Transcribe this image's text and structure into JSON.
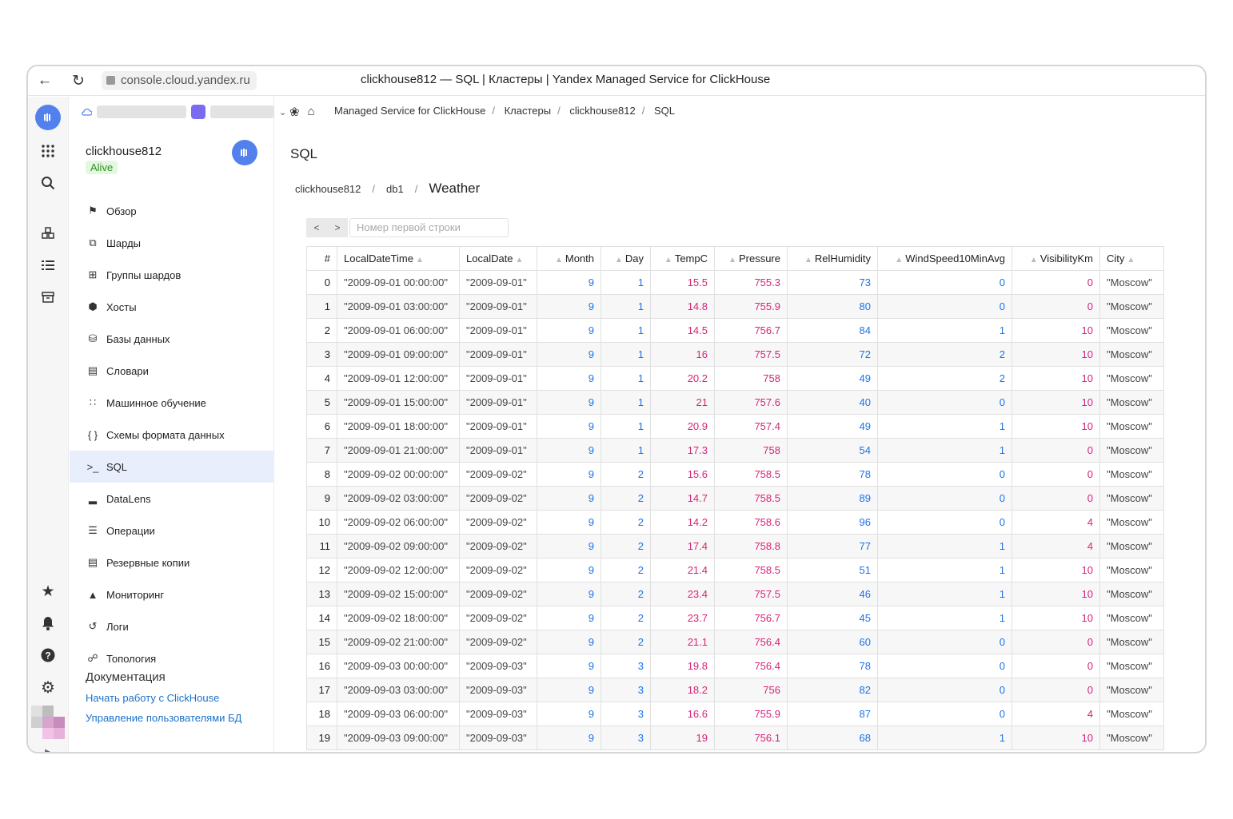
{
  "browser": {
    "url": "console.cloud.yandex.ru",
    "title": "clickhouse812 — SQL | Кластеры | Yandex Managed Service for ClickHouse"
  },
  "cluster": {
    "name": "clickhouse812",
    "status": "Alive"
  },
  "breadcrumbs": [
    "Managed Service for ClickHouse",
    "Кластеры",
    "clickhouse812",
    "SQL"
  ],
  "menu": [
    {
      "label": "Обзор",
      "icon": "flag-icon"
    },
    {
      "label": "Шарды",
      "icon": "shards-icon"
    },
    {
      "label": "Группы шардов",
      "icon": "shard-groups-icon"
    },
    {
      "label": "Хосты",
      "icon": "cube-icon"
    },
    {
      "label": "Базы данных",
      "icon": "database-icon"
    },
    {
      "label": "Словари",
      "icon": "dictionary-icon"
    },
    {
      "label": "Машинное обучение",
      "icon": "ml-icon"
    },
    {
      "label": "Схемы формата данных",
      "icon": "braces-icon"
    },
    {
      "label": "SQL",
      "icon": "terminal-icon",
      "active": true
    },
    {
      "label": "DataLens",
      "icon": "chart-icon"
    },
    {
      "label": "Операции",
      "icon": "list-icon"
    },
    {
      "label": "Резервные копии",
      "icon": "archive-icon"
    },
    {
      "label": "Мониторинг",
      "icon": "monitoring-icon"
    },
    {
      "label": "Логи",
      "icon": "history-icon"
    },
    {
      "label": "Топология",
      "icon": "topology-icon"
    }
  ],
  "docs": {
    "heading": "Документация",
    "links": [
      "Начать работу с ClickHouse",
      "Управление пользователями БД"
    ]
  },
  "page": {
    "title": "SQL",
    "path": [
      "clickhouse812",
      "db1"
    ],
    "table_name": "Weather",
    "pager_prev": "<",
    "pager_next": ">",
    "first_row_placeholder": "Номер первой строки"
  },
  "table": {
    "columns": [
      "#",
      "LocalDateTime",
      "LocalDate",
      "Month",
      "Day",
      "TempC",
      "Pressure",
      "RelHumidity",
      "WindSpeed10MinAvg",
      "VisibilityKm",
      "City"
    ],
    "rows": [
      [
        "0",
        "\"2009-09-01 00:00:00\"",
        "\"2009-09-01\"",
        "9",
        "1",
        "15.5",
        "755.3",
        "73",
        "0",
        "0",
        "\"Moscow\""
      ],
      [
        "1",
        "\"2009-09-01 03:00:00\"",
        "\"2009-09-01\"",
        "9",
        "1",
        "14.8",
        "755.9",
        "80",
        "0",
        "0",
        "\"Moscow\""
      ],
      [
        "2",
        "\"2009-09-01 06:00:00\"",
        "\"2009-09-01\"",
        "9",
        "1",
        "14.5",
        "756.7",
        "84",
        "1",
        "10",
        "\"Moscow\""
      ],
      [
        "3",
        "\"2009-09-01 09:00:00\"",
        "\"2009-09-01\"",
        "9",
        "1",
        "16",
        "757.5",
        "72",
        "2",
        "10",
        "\"Moscow\""
      ],
      [
        "4",
        "\"2009-09-01 12:00:00\"",
        "\"2009-09-01\"",
        "9",
        "1",
        "20.2",
        "758",
        "49",
        "2",
        "10",
        "\"Moscow\""
      ],
      [
        "5",
        "\"2009-09-01 15:00:00\"",
        "\"2009-09-01\"",
        "9",
        "1",
        "21",
        "757.6",
        "40",
        "0",
        "10",
        "\"Moscow\""
      ],
      [
        "6",
        "\"2009-09-01 18:00:00\"",
        "\"2009-09-01\"",
        "9",
        "1",
        "20.9",
        "757.4",
        "49",
        "1",
        "10",
        "\"Moscow\""
      ],
      [
        "7",
        "\"2009-09-01 21:00:00\"",
        "\"2009-09-01\"",
        "9",
        "1",
        "17.3",
        "758",
        "54",
        "1",
        "0",
        "\"Moscow\""
      ],
      [
        "8",
        "\"2009-09-02 00:00:00\"",
        "\"2009-09-02\"",
        "9",
        "2",
        "15.6",
        "758.5",
        "78",
        "0",
        "0",
        "\"Moscow\""
      ],
      [
        "9",
        "\"2009-09-02 03:00:00\"",
        "\"2009-09-02\"",
        "9",
        "2",
        "14.7",
        "758.5",
        "89",
        "0",
        "0",
        "\"Moscow\""
      ],
      [
        "10",
        "\"2009-09-02 06:00:00\"",
        "\"2009-09-02\"",
        "9",
        "2",
        "14.2",
        "758.6",
        "96",
        "0",
        "4",
        "\"Moscow\""
      ],
      [
        "11",
        "\"2009-09-02 09:00:00\"",
        "\"2009-09-02\"",
        "9",
        "2",
        "17.4",
        "758.8",
        "77",
        "1",
        "4",
        "\"Moscow\""
      ],
      [
        "12",
        "\"2009-09-02 12:00:00\"",
        "\"2009-09-02\"",
        "9",
        "2",
        "21.4",
        "758.5",
        "51",
        "1",
        "10",
        "\"Moscow\""
      ],
      [
        "13",
        "\"2009-09-02 15:00:00\"",
        "\"2009-09-02\"",
        "9",
        "2",
        "23.4",
        "757.5",
        "46",
        "1",
        "10",
        "\"Moscow\""
      ],
      [
        "14",
        "\"2009-09-02 18:00:00\"",
        "\"2009-09-02\"",
        "9",
        "2",
        "23.7",
        "756.7",
        "45",
        "1",
        "10",
        "\"Moscow\""
      ],
      [
        "15",
        "\"2009-09-02 21:00:00\"",
        "\"2009-09-02\"",
        "9",
        "2",
        "21.1",
        "756.4",
        "60",
        "0",
        "0",
        "\"Moscow\""
      ],
      [
        "16",
        "\"2009-09-03 00:00:00\"",
        "\"2009-09-03\"",
        "9",
        "3",
        "19.8",
        "756.4",
        "78",
        "0",
        "0",
        "\"Moscow\""
      ],
      [
        "17",
        "\"2009-09-03 03:00:00\"",
        "\"2009-09-03\"",
        "9",
        "3",
        "18.2",
        "756",
        "82",
        "0",
        "0",
        "\"Moscow\""
      ],
      [
        "18",
        "\"2009-09-03 06:00:00\"",
        "\"2009-09-03\"",
        "9",
        "3",
        "16.6",
        "755.9",
        "87",
        "0",
        "4",
        "\"Moscow\""
      ],
      [
        "19",
        "\"2009-09-03 09:00:00\"",
        "\"2009-09-03\"",
        "9",
        "3",
        "19",
        "756.1",
        "68",
        "1",
        "10",
        "\"Moscow\""
      ]
    ]
  },
  "colors": {
    "accent": "#5281ee",
    "number_blue": "#1a73e8",
    "number_pink": "#d6247a",
    "status_green": "#2f8f23"
  }
}
